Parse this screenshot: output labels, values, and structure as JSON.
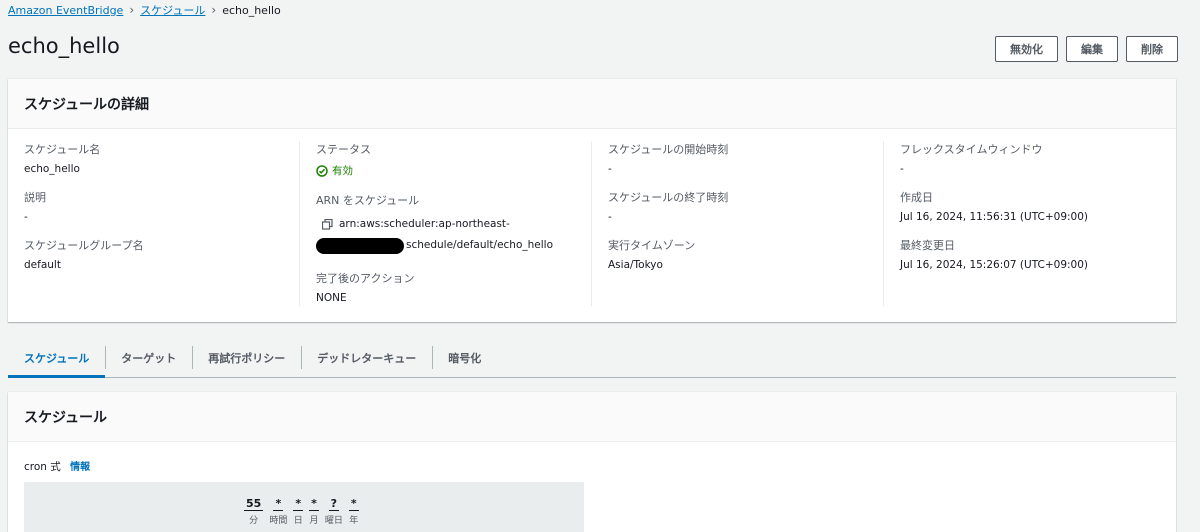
{
  "breadcrumb": {
    "items": [
      "Amazon EventBridge",
      "スケジュール"
    ],
    "current": "echo_hello"
  },
  "page": {
    "title": "echo_hello",
    "buttons": {
      "disable": "無効化",
      "edit": "編集",
      "delete": "削除"
    }
  },
  "details": {
    "header": "スケジュールの詳細",
    "schedule_name": {
      "label": "スケジュール名",
      "value": "echo_hello"
    },
    "description": {
      "label": "説明",
      "value": "-"
    },
    "group": {
      "label": "スケジュールグループ名",
      "value": "default"
    },
    "status": {
      "label": "ステータス",
      "value": "有効"
    },
    "arn": {
      "label": "ARN をスケジュール",
      "line1": "arn:aws:scheduler:ap-northeast-",
      "line2": "schedule/default/echo_hello"
    },
    "after_action": {
      "label": "完了後のアクション",
      "value": "NONE"
    },
    "start_time": {
      "label": "スケジュールの開始時刻",
      "value": "-"
    },
    "end_time": {
      "label": "スケジュールの終了時刻",
      "value": "-"
    },
    "timezone": {
      "label": "実行タイムゾーン",
      "value": "Asia/Tokyo"
    },
    "flex_window": {
      "label": "フレックスタイムウィンドウ",
      "value": "-"
    },
    "created": {
      "label": "作成日",
      "value": "Jul 16, 2024, 11:56:31 (UTC+09:00)"
    },
    "modified": {
      "label": "最終変更日",
      "value": "Jul 16, 2024, 15:26:07 (UTC+09:00)"
    }
  },
  "tabs": [
    "スケジュール",
    "ターゲット",
    "再試行ポリシー",
    "デッドレターキュー",
    "暗号化"
  ],
  "schedule_card": {
    "header": "スケジュール",
    "cron_label": "cron 式",
    "info_link": "情報",
    "cron": [
      {
        "value": "55",
        "unit": "分"
      },
      {
        "value": "*",
        "unit": "時間"
      },
      {
        "value": "*",
        "unit": "日"
      },
      {
        "value": "*",
        "unit": "月"
      },
      {
        "value": "?",
        "unit": "曜日"
      },
      {
        "value": "*",
        "unit": "年"
      }
    ]
  },
  "colors": {
    "link": "#0073bb",
    "success": "#1d8102",
    "background": "#f2f3f3"
  }
}
